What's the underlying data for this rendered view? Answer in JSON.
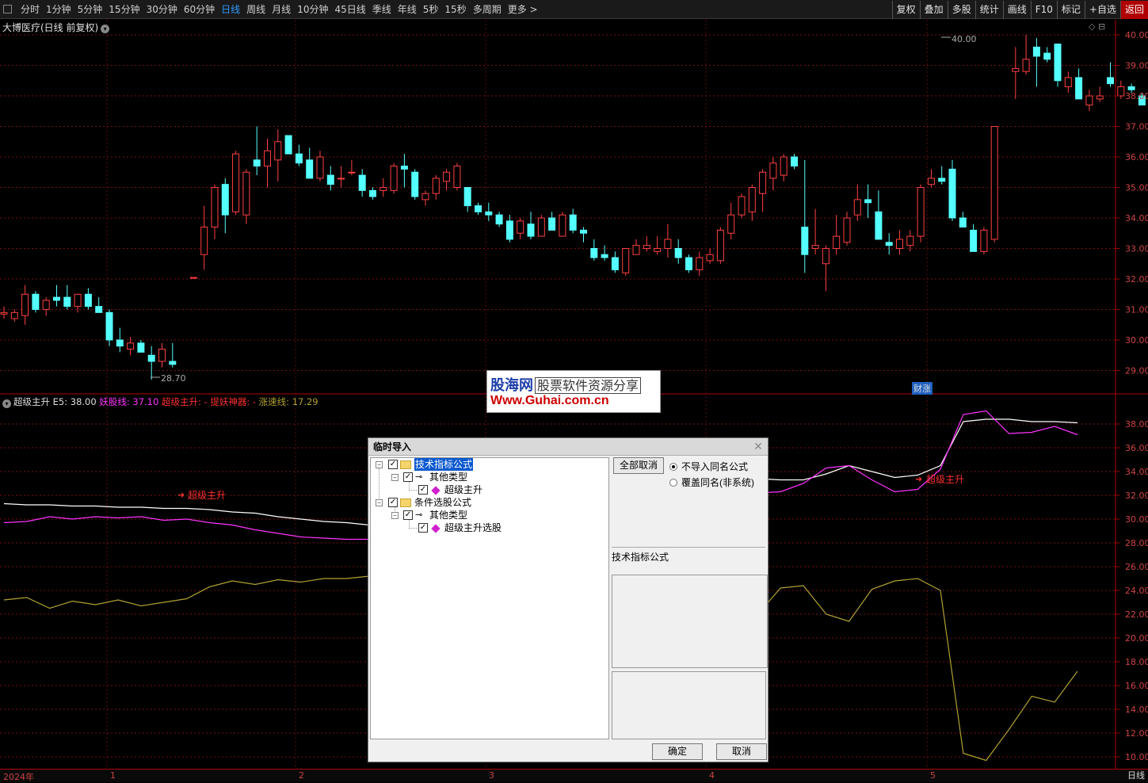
{
  "toolbar": {
    "timeframes": [
      "分时",
      "1分钟",
      "5分钟",
      "15分钟",
      "30分钟",
      "60分钟",
      "日线",
      "周线",
      "月线",
      "10分钟",
      "45日线",
      "季线",
      "年线",
      "5秒",
      "15秒",
      "多周期",
      "更多 >"
    ],
    "active_timeframe": "日线",
    "right_buttons": [
      "复权",
      "叠加",
      "多股",
      "统计",
      "画线",
      "F10",
      "标记",
      "+自选",
      "返回"
    ],
    "selected_right": "返回"
  },
  "stock": {
    "title": "大博医疗(日线 前复权)",
    "high_label": "40.00",
    "low_label": "28.70"
  },
  "price_axis": [
    "40.00",
    "39.00",
    "38.00",
    "37.00",
    "36.00",
    "35.00",
    "34.00",
    "33.00",
    "32.00",
    "31.00",
    "30.00",
    "29.00"
  ],
  "indicator": {
    "name": "超级主升",
    "e5": "E5: 38.00",
    "yao_label": "妖股线:",
    "yao_value": "37.10",
    "chao_label": "超级主升:",
    "chao_value": "-",
    "ti_label": "提妖神器:",
    "ti_value": "-",
    "zhang_label": "涨速线:",
    "zhang_value": "17.29",
    "signals": [
      "超级主升",
      "超级主升"
    ],
    "axis": [
      "38.00",
      "36.00",
      "34.00",
      "32.00",
      "30.00",
      "28.00",
      "26.00",
      "24.00",
      "22.00",
      "20.00",
      "18.00",
      "16.00",
      "14.00",
      "12.00",
      "10.00"
    ]
  },
  "xaxis": {
    "labels": [
      "2024年",
      "1",
      "2",
      "3",
      "4",
      "5"
    ],
    "period": "日线"
  },
  "badge": "财涨",
  "watermark": {
    "brand": "股海网",
    "slogan": "股票软件资源分享",
    "url": "Www.Guhai.com.cn"
  },
  "dialog": {
    "title": "临时导入",
    "tree": [
      {
        "label": "技术指标公式",
        "children": [
          {
            "label": "其他类型",
            "children": [
              {
                "label": "超级主升"
              }
            ]
          }
        ]
      },
      {
        "label": "条件选股公式",
        "children": [
          {
            "label": "其他类型",
            "children": [
              {
                "label": "超级主升选股"
              }
            ]
          }
        ]
      }
    ],
    "deselect_all": "全部取消",
    "radio_no_import": "不导入同名公式",
    "radio_overwrite": "覆盖同名(非系统)",
    "description": "技术指标公式",
    "ok": "确定",
    "cancel": "取消"
  },
  "colors": {
    "up": "#ff4040",
    "down": "#54ffff",
    "yao": "#ff33ff",
    "e5": "#ffffff",
    "zhang": "#b0a030",
    "accent": "#2f9bff",
    "signal": "#ff3030"
  },
  "chart_data": {
    "candles": [
      {
        "o": 30.85,
        "h": 31.1,
        "l": 30.7,
        "c": 30.9
      },
      {
        "o": 30.7,
        "h": 31.0,
        "l": 30.6,
        "c": 30.9
      },
      {
        "o": 30.8,
        "h": 31.8,
        "l": 30.5,
        "c": 31.5
      },
      {
        "o": 31.5,
        "h": 31.6,
        "l": 30.9,
        "c": 31.0
      },
      {
        "o": 31.0,
        "h": 31.4,
        "l": 30.8,
        "c": 31.3
      },
      {
        "o": 31.4,
        "h": 31.8,
        "l": 31.1,
        "c": 31.3
      },
      {
        "o": 31.4,
        "h": 31.8,
        "l": 31.0,
        "c": 31.1
      },
      {
        "o": 31.1,
        "h": 31.5,
        "l": 30.9,
        "c": 31.5
      },
      {
        "o": 31.5,
        "h": 31.7,
        "l": 31.0,
        "c": 31.1
      },
      {
        "o": 31.1,
        "h": 31.4,
        "l": 30.9,
        "c": 30.9
      },
      {
        "o": 30.9,
        "h": 31.0,
        "l": 29.8,
        "c": 30.0
      },
      {
        "o": 30.0,
        "h": 30.4,
        "l": 29.6,
        "c": 29.8
      },
      {
        "o": 29.7,
        "h": 30.1,
        "l": 29.5,
        "c": 29.9
      },
      {
        "o": 29.9,
        "h": 30.0,
        "l": 29.6,
        "c": 29.6
      },
      {
        "o": 29.5,
        "h": 29.8,
        "l": 28.7,
        "c": 29.3
      },
      {
        "o": 29.3,
        "h": 29.9,
        "l": 29.1,
        "c": 29.7
      },
      {
        "o": 29.3,
        "h": 29.9,
        "l": 29.1,
        "c": 29.2
      },
      null,
      {
        "o": 32.05,
        "h": 32.05,
        "l": 32.05,
        "c": 32.05
      },
      {
        "o": 32.8,
        "h": 34.4,
        "l": 32.3,
        "c": 33.7
      },
      {
        "o": 33.7,
        "h": 35.1,
        "l": 33.3,
        "c": 35.0
      },
      {
        "o": 35.1,
        "h": 35.3,
        "l": 33.5,
        "c": 34.1
      },
      {
        "o": 34.2,
        "h": 36.2,
        "l": 34.1,
        "c": 36.1
      },
      {
        "o": 34.1,
        "h": 35.6,
        "l": 33.8,
        "c": 35.5
      },
      {
        "o": 35.9,
        "h": 37.0,
        "l": 35.4,
        "c": 35.7
      },
      {
        "o": 35.7,
        "h": 36.6,
        "l": 35.0,
        "c": 36.2
      },
      {
        "o": 35.9,
        "h": 36.9,
        "l": 35.2,
        "c": 36.5
      },
      {
        "o": 36.7,
        "h": 36.7,
        "l": 36.1,
        "c": 36.1
      },
      {
        "o": 36.1,
        "h": 36.4,
        "l": 35.7,
        "c": 35.8
      },
      {
        "o": 35.9,
        "h": 36.3,
        "l": 35.3,
        "c": 35.3
      },
      {
        "o": 35.3,
        "h": 36.2,
        "l": 35.2,
        "c": 36.0
      },
      {
        "o": 35.4,
        "h": 35.7,
        "l": 34.9,
        "c": 35.1
      },
      {
        "o": 35.3,
        "h": 35.7,
        "l": 35.0,
        "c": 35.3
      },
      {
        "o": 35.5,
        "h": 35.9,
        "l": 35.4,
        "c": 35.5
      },
      {
        "o": 35.4,
        "h": 35.6,
        "l": 34.7,
        "c": 34.9
      },
      {
        "o": 34.9,
        "h": 35.0,
        "l": 34.6,
        "c": 34.7
      },
      {
        "o": 34.9,
        "h": 35.3,
        "l": 34.7,
        "c": 35.0
      },
      {
        "o": 34.9,
        "h": 35.8,
        "l": 34.8,
        "c": 35.7
      },
      {
        "o": 35.7,
        "h": 36.1,
        "l": 35.0,
        "c": 35.6
      },
      {
        "o": 35.5,
        "h": 35.6,
        "l": 34.6,
        "c": 34.7
      },
      {
        "o": 34.6,
        "h": 34.9,
        "l": 34.4,
        "c": 34.8
      },
      {
        "o": 34.8,
        "h": 35.4,
        "l": 34.6,
        "c": 35.3
      },
      {
        "o": 35.2,
        "h": 35.6,
        "l": 34.9,
        "c": 35.5
      },
      {
        "o": 35.0,
        "h": 35.8,
        "l": 34.9,
        "c": 35.7
      },
      {
        "o": 35.0,
        "h": 35.0,
        "l": 34.2,
        "c": 34.4
      },
      {
        "o": 34.4,
        "h": 34.5,
        "l": 34.1,
        "c": 34.2
      },
      {
        "o": 34.2,
        "h": 34.5,
        "l": 33.9,
        "c": 34.1
      },
      {
        "o": 34.1,
        "h": 34.2,
        "l": 33.7,
        "c": 33.8
      },
      {
        "o": 33.9,
        "h": 34.1,
        "l": 33.2,
        "c": 33.3
      },
      {
        "o": 33.5,
        "h": 34.0,
        "l": 33.3,
        "c": 33.9
      },
      {
        "o": 33.8,
        "h": 34.2,
        "l": 33.3,
        "c": 33.4
      },
      {
        "o": 33.4,
        "h": 34.1,
        "l": 33.4,
        "c": 34.0
      },
      {
        "o": 34.0,
        "h": 34.2,
        "l": 33.6,
        "c": 33.6
      },
      {
        "o": 33.4,
        "h": 34.2,
        "l": 33.4,
        "c": 34.1
      },
      {
        "o": 34.1,
        "h": 34.3,
        "l": 33.5,
        "c": 33.6
      },
      {
        "o": 33.6,
        "h": 33.7,
        "l": 33.2,
        "c": 33.5
      },
      {
        "o": 33.0,
        "h": 33.3,
        "l": 32.6,
        "c": 32.7
      },
      {
        "o": 32.8,
        "h": 33.1,
        "l": 32.6,
        "c": 32.7
      },
      {
        "o": 32.7,
        "h": 32.9,
        "l": 32.2,
        "c": 32.3
      },
      {
        "o": 32.2,
        "h": 33.0,
        "l": 32.1,
        "c": 33.0
      },
      {
        "o": 32.8,
        "h": 33.3,
        "l": 32.8,
        "c": 33.1
      },
      {
        "o": 33.0,
        "h": 33.4,
        "l": 32.9,
        "c": 33.1
      },
      {
        "o": 32.9,
        "h": 33.4,
        "l": 32.8,
        "c": 33.0
      },
      {
        "o": 33.0,
        "h": 33.8,
        "l": 32.7,
        "c": 33.3
      },
      {
        "o": 33.0,
        "h": 33.3,
        "l": 32.5,
        "c": 32.7
      },
      {
        "o": 32.7,
        "h": 32.8,
        "l": 32.2,
        "c": 32.3
      },
      {
        "o": 32.3,
        "h": 32.9,
        "l": 32.1,
        "c": 32.7
      },
      {
        "o": 32.6,
        "h": 33.0,
        "l": 32.5,
        "c": 32.8
      },
      {
        "o": 32.6,
        "h": 33.7,
        "l": 32.5,
        "c": 33.6
      },
      {
        "o": 33.5,
        "h": 34.5,
        "l": 33.3,
        "c": 34.1
      },
      {
        "o": 34.1,
        "h": 34.8,
        "l": 34.0,
        "c": 34.7
      },
      {
        "o": 34.2,
        "h": 35.1,
        "l": 33.9,
        "c": 35.0
      },
      {
        "o": 34.8,
        "h": 35.6,
        "l": 34.2,
        "c": 35.5
      },
      {
        "o": 35.3,
        "h": 36.0,
        "l": 34.9,
        "c": 35.8
      },
      {
        "o": 35.4,
        "h": 36.1,
        "l": 35.2,
        "c": 36.0
      },
      {
        "o": 36.0,
        "h": 36.1,
        "l": 35.6,
        "c": 35.7
      },
      {
        "o": 33.7,
        "h": 35.9,
        "l": 32.2,
        "c": 32.8
      },
      {
        "o": 33.0,
        "h": 34.3,
        "l": 32.8,
        "c": 33.1
      },
      {
        "o": 32.5,
        "h": 33.1,
        "l": 31.6,
        "c": 33.0
      },
      {
        "o": 33.0,
        "h": 34.1,
        "l": 32.8,
        "c": 33.4
      },
      {
        "o": 33.2,
        "h": 34.2,
        "l": 33.1,
        "c": 34.0
      },
      {
        "o": 34.1,
        "h": 35.1,
        "l": 33.9,
        "c": 34.6
      },
      {
        "o": 34.6,
        "h": 35.1,
        "l": 34.0,
        "c": 34.5
      },
      {
        "o": 34.2,
        "h": 34.9,
        "l": 33.3,
        "c": 33.3
      },
      {
        "o": 33.2,
        "h": 33.5,
        "l": 32.8,
        "c": 33.1
      },
      {
        "o": 33.0,
        "h": 33.6,
        "l": 32.8,
        "c": 33.3
      },
      {
        "o": 33.1,
        "h": 33.6,
        "l": 32.9,
        "c": 33.4
      },
      {
        "o": 33.4,
        "h": 35.1,
        "l": 33.2,
        "c": 35.0
      },
      {
        "o": 35.1,
        "h": 35.6,
        "l": 35.0,
        "c": 35.3
      },
      {
        "o": 35.3,
        "h": 35.7,
        "l": 35.1,
        "c": 35.2
      },
      {
        "o": 35.6,
        "h": 35.9,
        "l": 33.9,
        "c": 34.0
      },
      {
        "o": 34.0,
        "h": 34.2,
        "l": 33.7,
        "c": 33.7
      },
      {
        "o": 33.6,
        "h": 33.8,
        "l": 32.9,
        "c": 32.9
      },
      {
        "o": 32.9,
        "h": 33.7,
        "l": 32.8,
        "c": 33.6
      },
      {
        "o": 33.3,
        "h": 37.0,
        "l": 33.2,
        "c": 37.0
      },
      null,
      {
        "o": 38.8,
        "h": 39.6,
        "l": 37.9,
        "c": 38.9
      },
      {
        "o": 38.8,
        "h": 40.0,
        "l": 38.7,
        "c": 39.2
      },
      {
        "o": 39.6,
        "h": 39.9,
        "l": 38.3,
        "c": 39.3
      },
      {
        "o": 39.4,
        "h": 39.6,
        "l": 39.1,
        "c": 39.2
      },
      {
        "o": 39.7,
        "h": 39.7,
        "l": 38.3,
        "c": 38.5
      },
      {
        "o": 38.3,
        "h": 38.8,
        "l": 38.1,
        "c": 38.6
      },
      {
        "o": 38.6,
        "h": 38.9,
        "l": 37.9,
        "c": 37.9
      },
      {
        "o": 37.7,
        "h": 38.2,
        "l": 37.5,
        "c": 38.0
      },
      {
        "o": 37.9,
        "h": 38.3,
        "l": 37.8,
        "c": 38.0
      },
      {
        "o": 38.6,
        "h": 39.1,
        "l": 38.3,
        "c": 38.4
      },
      {
        "o": 38.0,
        "h": 38.5,
        "l": 37.9,
        "c": 38.3
      },
      {
        "o": 38.3,
        "h": 38.4,
        "l": 38.1,
        "c": 38.2
      },
      {
        "o": 38.0,
        "h": 38.1,
        "l": 37.7,
        "c": 37.7
      },
      {
        "o": 37.9,
        "h": 38.7,
        "l": 37.8,
        "c": 38.1
      },
      {
        "o": 37.8,
        "h": 38.1,
        "l": 37.7,
        "c": 37.9
      }
    ],
    "white_line": [
      31.3,
      31.2,
      31.2,
      31.1,
      31.1,
      31.0,
      31.0,
      30.9,
      30.9,
      30.8,
      30.6,
      30.5,
      30.2,
      30.0,
      29.8,
      29.7,
      29.5,
      29.5,
      31.6,
      33.0,
      34.1,
      35.0,
      35.6,
      35.8,
      35.8,
      35.6,
      35.4,
      35.3,
      35.2,
      35.0,
      34.5,
      33.9,
      33.6,
      33.4,
      33.3,
      33.3,
      33.8,
      34.5,
      34.0,
      33.5,
      33.7,
      34.5,
      38.2,
      38.4,
      38.4,
      38.2,
      38.2,
      38.1
    ],
    "magenta_line": [
      29.7,
      29.8,
      30.2,
      30.0,
      30.2,
      30.1,
      30.2,
      29.9,
      30.0,
      29.7,
      29.5,
      29.1,
      28.8,
      28.5,
      28.4,
      28.3,
      28.3,
      28.2,
      31.3,
      33.5,
      34.5,
      35.5,
      36.0,
      36.2,
      35.7,
      35.1,
      34.6,
      34.7,
      34.8,
      34.3,
      33.9,
      33.4,
      32.6,
      32.2,
      32.3,
      33.0,
      34.3,
      34.5,
      33.3,
      32.3,
      32.5,
      34.2,
      38.8,
      39.1,
      37.2,
      37.3,
      37.8,
      37.1
    ],
    "yellow_line": [
      23.2,
      23.4,
      22.5,
      23.1,
      22.8,
      23.2,
      22.7,
      23.0,
      23.3,
      24.3,
      24.8,
      24.5,
      24.9,
      24.7,
      25.0,
      25.0,
      25.2,
      25.0,
      15.3,
      16.5,
      14.0,
      13.0,
      11.5,
      12.6,
      15.2,
      15.3,
      15.7,
      15.1,
      16.8,
      17.5,
      16.2,
      22.0,
      23.3,
      22.0,
      24.2,
      24.4,
      22.0,
      21.4,
      24.1,
      24.8,
      25.0,
      24.0,
      10.3,
      9.7,
      12.3,
      15.1,
      14.6,
      17.2
    ]
  }
}
